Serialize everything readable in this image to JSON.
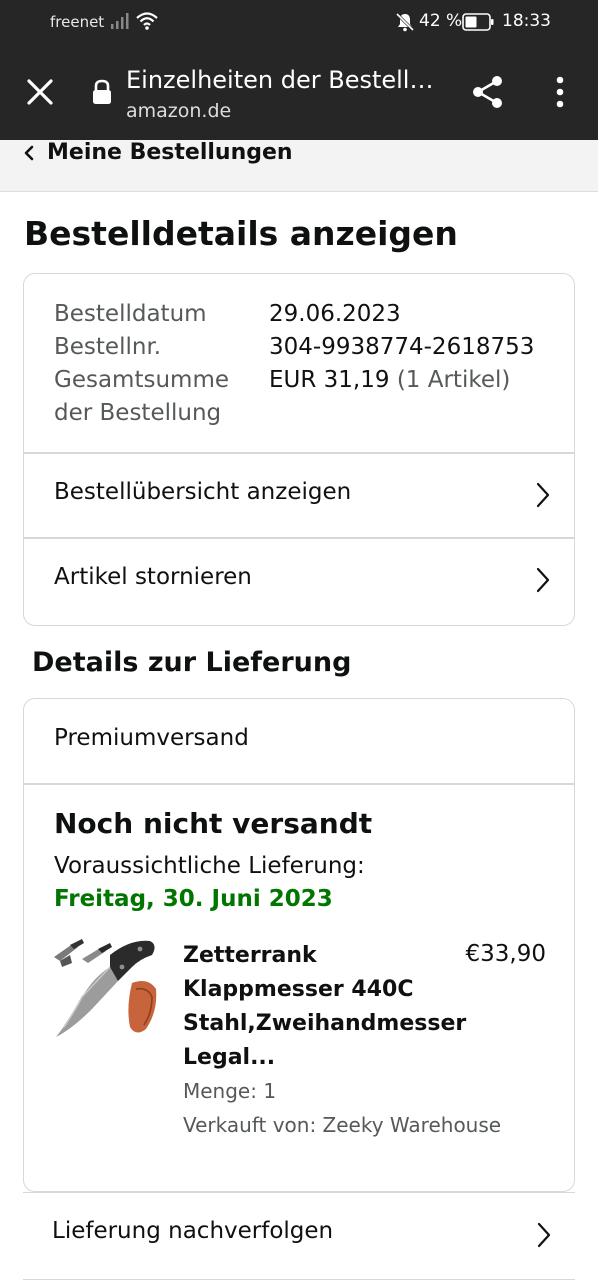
{
  "status_bar": {
    "carrier": "freenet",
    "battery_percent": "42 %",
    "time": "18:33",
    "icons": [
      "signal-icon",
      "wifi-icon",
      "bell-muted-icon",
      "battery-icon"
    ]
  },
  "browser": {
    "title": "Einzelheiten der Bestellung",
    "url": "amazon.de",
    "icons": [
      "close-icon",
      "lock-icon",
      "share-icon",
      "more-vertical-icon"
    ]
  },
  "breadcrumb": {
    "label": "Meine Bestellungen"
  },
  "page_title": "Bestelldetails anzeigen",
  "order_info": {
    "date_label": "Bestelldatum",
    "date_value": "29.06.2023",
    "number_label": "Bestellnr.",
    "number_value": "304-9938774-2618753",
    "total_label_line1": "Gesamtsumme",
    "total_label_line2": "der Bestellung",
    "total_value": "EUR 31,19",
    "total_items": "(1 Artikel)"
  },
  "order_actions": {
    "summary_label": "Bestellübersicht anzeigen",
    "cancel_label": "Artikel stornieren"
  },
  "delivery": {
    "section_title": "Details zur Lieferung",
    "shipping_method": "Premiumversand",
    "status": "Noch nicht versandt",
    "eta_label": "Voraussichtliche Lieferung:",
    "eta_date": "Freitag, 30. Juni 2023",
    "eta_color": "#007600"
  },
  "product": {
    "name": "Zetterrank Klappmesser 440C Stahl,Zweihandmesser Legal...",
    "price": "€33,90",
    "quantity": "Menge: 1",
    "seller": "Verkauft von: Zeeky Warehouse"
  },
  "tracking": {
    "label": "Lieferung nachverfolgen"
  }
}
